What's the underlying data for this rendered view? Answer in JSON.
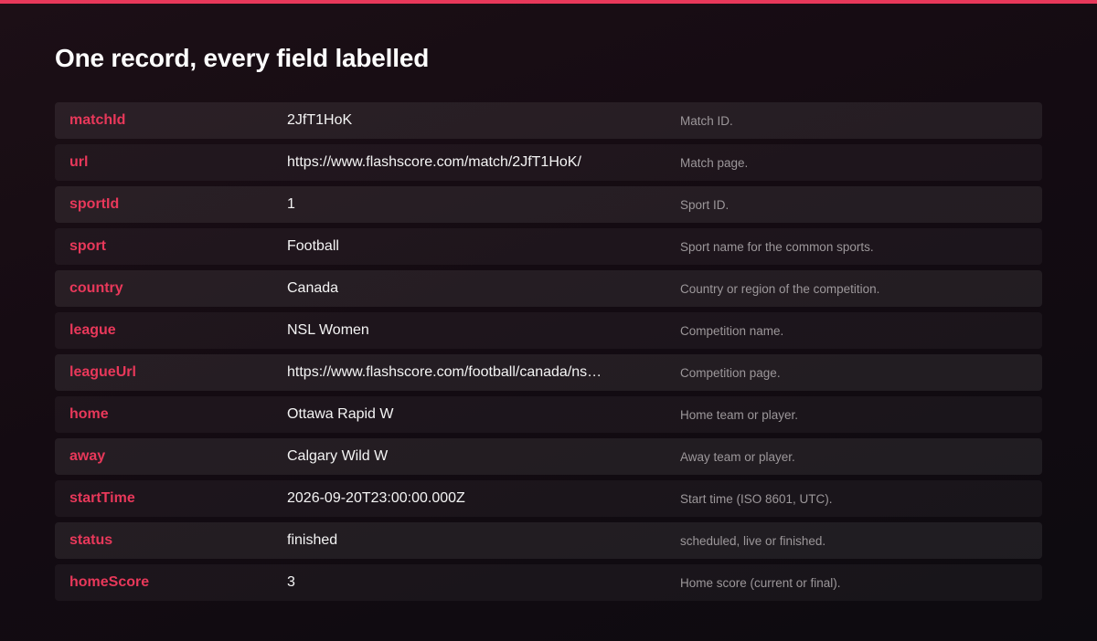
{
  "page": {
    "title": "One record, every field labelled"
  },
  "colors": {
    "accent": "#e8385a",
    "field_name": "#e8385a"
  },
  "fields": [
    {
      "name": "matchId",
      "value": "2JfT1HoK",
      "description": "Match ID."
    },
    {
      "name": "url",
      "value": "https://www.flashscore.com/match/2JfT1HoK/",
      "description": "Match page."
    },
    {
      "name": "sportId",
      "value": "1",
      "description": "Sport ID."
    },
    {
      "name": "sport",
      "value": "Football",
      "description": "Sport name for the common sports."
    },
    {
      "name": "country",
      "value": "Canada",
      "description": "Country or region of the competition."
    },
    {
      "name": "league",
      "value": "NSL Women",
      "description": "Competition name."
    },
    {
      "name": "leagueUrl",
      "value": "https://www.flashscore.com/football/canada/ns…",
      "description": "Competition page."
    },
    {
      "name": "home",
      "value": "Ottawa Rapid W",
      "description": "Home team or player."
    },
    {
      "name": "away",
      "value": "Calgary Wild W",
      "description": "Away team or player."
    },
    {
      "name": "startTime",
      "value": "2026-09-20T23:00:00.000Z",
      "description": "Start time (ISO 8601, UTC)."
    },
    {
      "name": "status",
      "value": "finished",
      "description": "scheduled, live or finished."
    },
    {
      "name": "homeScore",
      "value": "3",
      "description": "Home score (current or final)."
    }
  ]
}
